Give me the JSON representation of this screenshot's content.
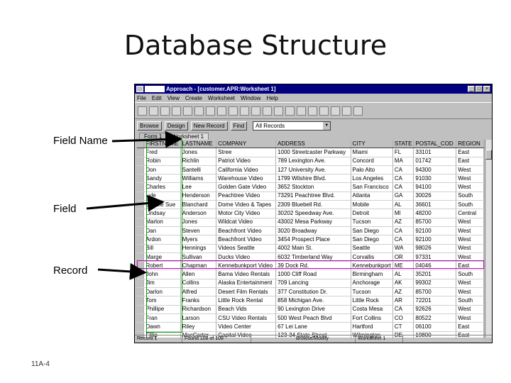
{
  "slide": {
    "title": "Database Structure",
    "callouts": {
      "field_name": "Field Name",
      "field": "Field",
      "record": "Record"
    },
    "slide_number": "11A-4"
  },
  "window": {
    "title": "Approach - [customer.APR:Worksheet 1]",
    "menus": [
      "File",
      "Edit",
      "View",
      "Create",
      "Worksheet",
      "Window",
      "Help"
    ],
    "toolbar2": {
      "browse": "Browse",
      "design": "Design",
      "new_record": "New Record",
      "find": "Find",
      "view_select": "All Records"
    },
    "tabs": [
      "Form 1",
      "Worksheet 1"
    ],
    "status": {
      "record": "Record 1",
      "found": "Found 108 of 108",
      "mode": "Browse/Modify",
      "view": "Worksheet 1"
    }
  },
  "table": {
    "columns": [
      "FIRSTNAME",
      "LASTNAME",
      "COMPANY",
      "ADDRESS",
      "CITY",
      "STATE",
      "POSTAL_COD",
      "REGION"
    ],
    "rows": [
      [
        "Fred",
        "Jones",
        "Stree",
        "1000 Streetcaster Parkway",
        "Miami",
        "FL",
        "33101",
        "East"
      ],
      [
        "Robin",
        "Richlin",
        "Patriot Video",
        "789 Lexington Ave.",
        "Concord",
        "MA",
        "01742",
        "East"
      ],
      [
        "Don",
        "Santelli",
        "California Video",
        "127 University Ave.",
        "Palo Alto",
        "CA",
        "94300",
        "West"
      ],
      [
        "Sandy",
        "Williams",
        "Warehouse Video",
        "1799 Wilshire Blvd.",
        "Los Angeles",
        "CA",
        "91030",
        "West"
      ],
      [
        "Charles",
        "Lee",
        "Golden Gate Video",
        "3652 Stockton",
        "San Francisco",
        "CA",
        "94100",
        "West"
      ],
      [
        "Lyle",
        "Henderson",
        "Peachtree Video",
        "73291 Peachtree Blvd.",
        "Atlanta",
        "GA",
        "30026",
        "South"
      ],
      [
        "Debbie Sue",
        "Blanchard",
        "Dome Video & Tapes",
        "2309 Bluebell Rd.",
        "Mobile",
        "AL",
        "36601",
        "South"
      ],
      [
        "Lindsay",
        "Anderson",
        "Motor City Video",
        "30202 Speedway Ave.",
        "Detroit",
        "MI",
        "48200",
        "Central"
      ],
      [
        "Marlon",
        "Jones",
        "Wildcat Video",
        "43002 Mesa Parkway",
        "Tucson",
        "AZ",
        "85700",
        "West"
      ],
      [
        "Dan",
        "Steven",
        "Beachfront Video",
        "3020 Broadway",
        "San Diego",
        "CA",
        "92100",
        "West"
      ],
      [
        "Ardon",
        "Myers",
        "Beachfront Video",
        "3454 Prospect Place",
        "San Diego",
        "CA",
        "92100",
        "West"
      ],
      [
        "Bill",
        "Hennings",
        "Videos Seattle",
        "4002 Main St.",
        "Seattle",
        "WA",
        "98026",
        "West"
      ],
      [
        "Marge",
        "Sullivan",
        "Ducks Video",
        "6032 Timberland Way",
        "Corvallis",
        "OR",
        "97331",
        "West"
      ],
      [
        "Robert",
        "Chapman",
        "Kennebunkport Video",
        "39 Dock Rd.",
        "Kennebunkport",
        "ME",
        "04046",
        "East"
      ],
      [
        "John",
        "Allen",
        "Bama Video Rentals",
        "1000 Cliff Road",
        "Birmingham",
        "AL",
        "35201",
        "South"
      ],
      [
        "Jim",
        "Collins",
        "Alaska Entertainment",
        "709 Lancing",
        "Anchorage",
        "AK",
        "99302",
        "West"
      ],
      [
        "Darlon",
        "Alfred",
        "Desert Film Rentals",
        "377 Constitution Dr.",
        "Tucson",
        "AZ",
        "85700",
        "West"
      ],
      [
        "Tom",
        "Franks",
        "Little Rock Rental",
        "858 Michigan Ave.",
        "Little Rock",
        "AR",
        "72201",
        "South"
      ],
      [
        "Phillipe",
        "Richardson",
        "Beach Vids",
        "90 Lexington Drive",
        "Costa Mesa",
        "CA",
        "92626",
        "West"
      ],
      [
        "Fran",
        "Larson",
        "CSU Video Rentals",
        "500 West Peach Blvd",
        "Fort Collins",
        "CO",
        "80522",
        "West"
      ],
      [
        "Dawn",
        "Riley",
        "Video Center",
        "67 Lei Lane",
        "Hartford",
        "CT",
        "06100",
        "East"
      ],
      [
        "Fillip",
        "MacCarter",
        "Capital Video",
        "123-34 State Street",
        "Wilmington",
        "DE",
        "19800",
        "East"
      ]
    ]
  }
}
